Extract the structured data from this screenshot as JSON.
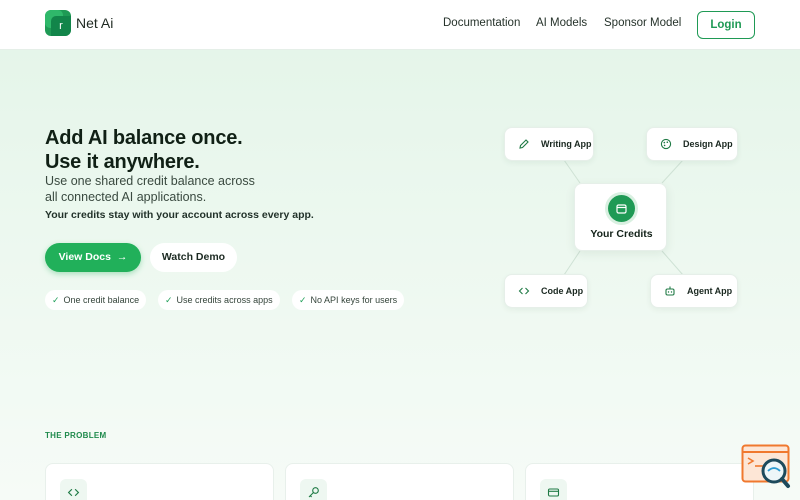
{
  "header": {
    "brand": "Net Ai",
    "logo_letter": "r",
    "nav": [
      "Documentation",
      "AI Models",
      "Sponsor Model"
    ],
    "login_label": "Login"
  },
  "hero": {
    "title_line1": "Add AI balance once.",
    "title_line2": "Use it anywhere.",
    "subtitle_line1": "Use one shared credit balance across",
    "subtitle_line2": "all connected AI applications.",
    "note": "Your credits stay with your account across every app.",
    "primary_button": "View Docs",
    "primary_arrow": "→",
    "secondary_button": "Watch Demo",
    "features": [
      "One credit balance",
      "Use credits across apps",
      "No API keys for users"
    ],
    "check": "✓"
  },
  "diagram": {
    "center_label": "Your Credits",
    "apps": [
      {
        "label": "Writing App",
        "icon": "pencil-icon"
      },
      {
        "label": "Design App",
        "icon": "palette-icon"
      },
      {
        "label": "Code App",
        "icon": "code-icon"
      },
      {
        "label": "Agent App",
        "icon": "robot-icon"
      }
    ]
  },
  "problem": {
    "section_label": "THE PROBLEM",
    "cards": [
      {
        "icon": "code-icon"
      },
      {
        "icon": "key-icon"
      },
      {
        "icon": "credit-card-icon"
      }
    ]
  },
  "colors": {
    "accent": "#21b05a",
    "brand_dark": "#1f9a55",
    "background": "#e8f6ec"
  }
}
